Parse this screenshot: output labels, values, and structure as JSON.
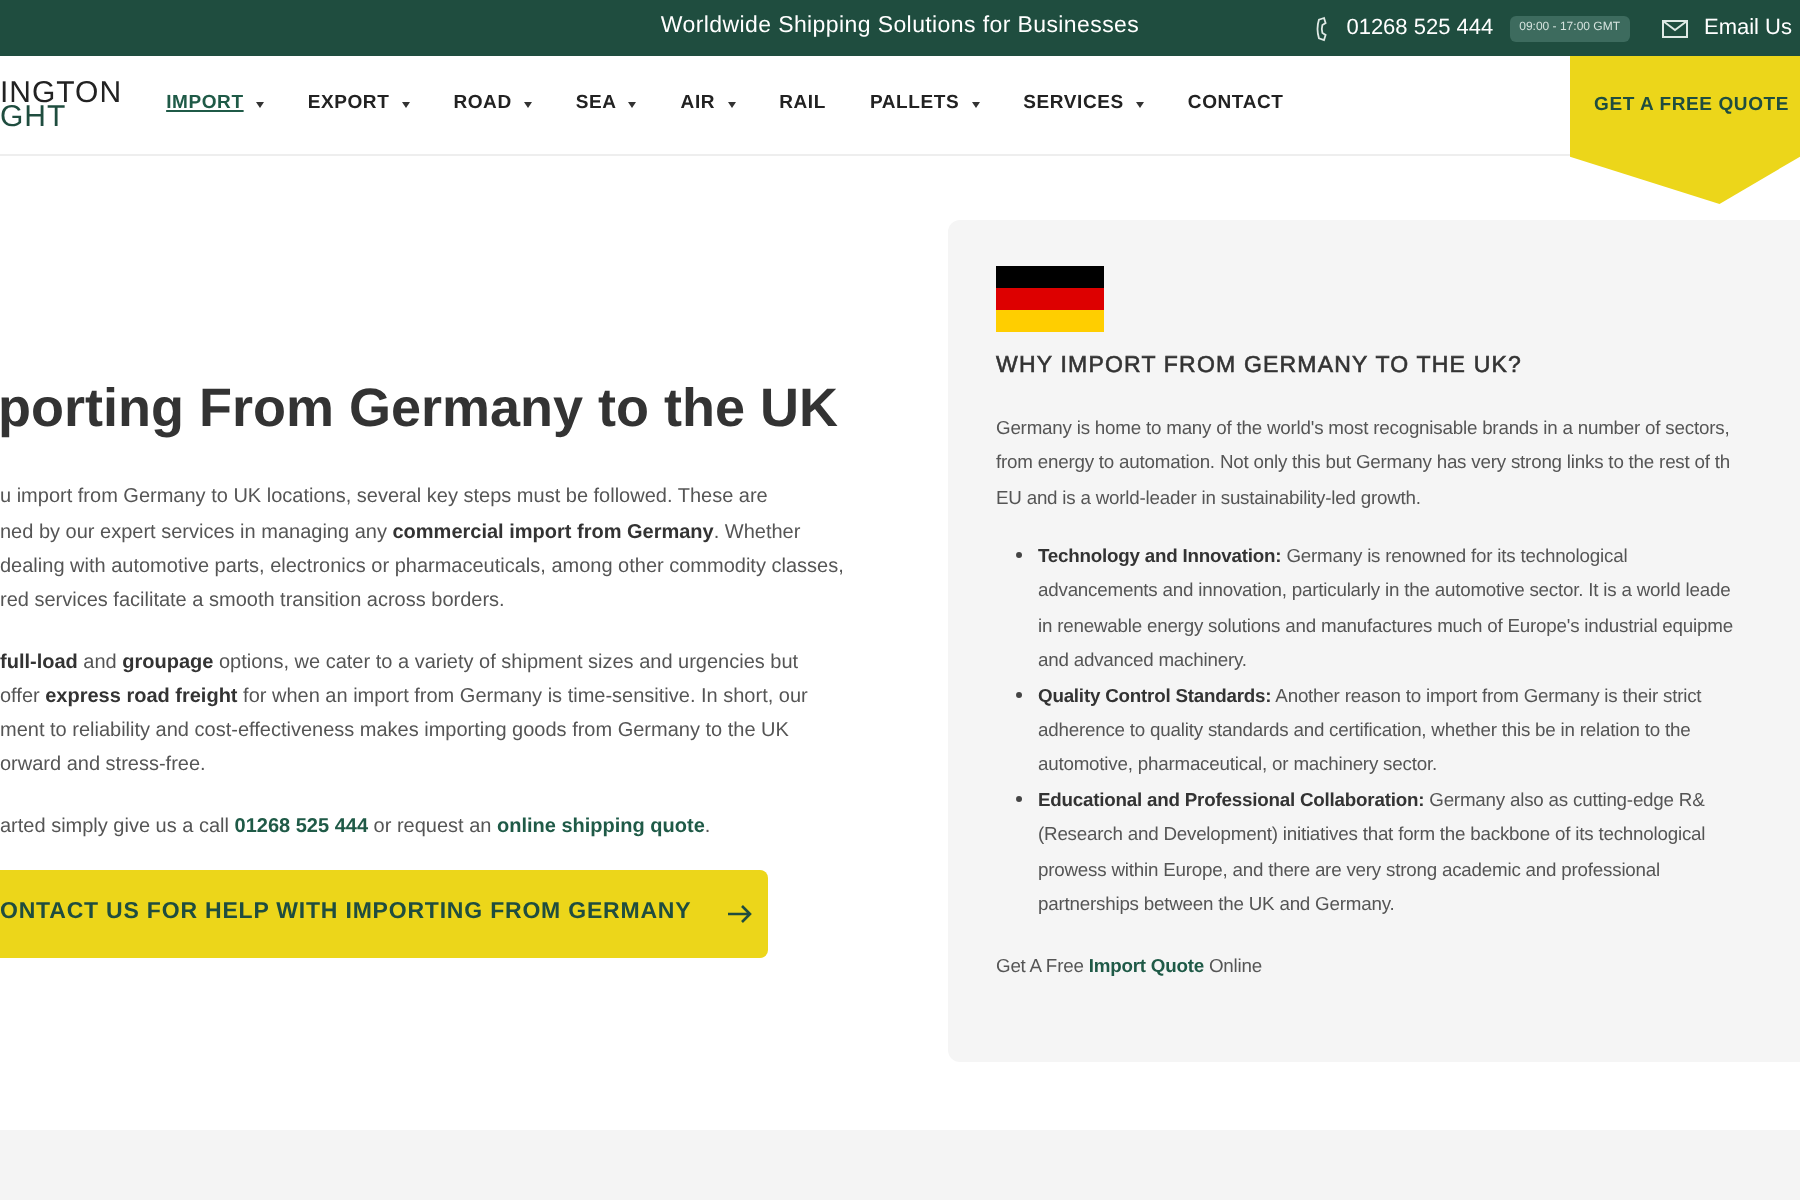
{
  "top_bar": {
    "tagline": "Worldwide Shipping Solutions for Businesses",
    "phone": "01268 525 444",
    "hours": "09:00 - 17:00 GMT",
    "email": "Email Us"
  },
  "header": {
    "logo_lines": [
      "INGTON",
      "GHT"
    ],
    "nav": [
      {
        "label": "IMPORT",
        "selected": true,
        "dropdown": true
      },
      {
        "label": "EXPORT",
        "selected": false,
        "dropdown": true
      },
      {
        "label": "ROAD",
        "selected": false,
        "dropdown": true
      },
      {
        "label": "SEA",
        "selected": false,
        "dropdown": true
      },
      {
        "label": "AIR",
        "selected": false,
        "dropdown": true
      },
      {
        "label": "RAIL",
        "selected": false,
        "dropdown": false
      },
      {
        "label": "PALLETS",
        "selected": false,
        "dropdown": true
      },
      {
        "label": "SERVICES",
        "selected": false,
        "dropdown": true
      },
      {
        "label": "CONTACT",
        "selected": false,
        "dropdown": false
      }
    ],
    "cta": "GET A FREE QUOTE"
  },
  "main": {
    "heading": "porting From Germany to the UK",
    "paragraphs": [
      {
        "lines": [
          [
            {
              "kind": "plain",
              "t": "u import from Germany to UK locations, several key steps must be followed. These are"
            }
          ],
          [
            {
              "kind": "plain",
              "t": "ned by our expert services in managing any "
            },
            {
              "kind": "bold",
              "t": "commercial import from Germany"
            },
            {
              "kind": "plain",
              "t": ". Whether"
            }
          ],
          [
            {
              "kind": "plain",
              "t": "dealing with automotive parts, electronics or pharmaceuticals, among other commodity classes,"
            }
          ],
          [
            {
              "kind": "plain",
              "t": "red services facilitate a smooth transition across borders."
            }
          ]
        ]
      },
      {
        "lines": [
          [
            {
              "kind": "bold",
              "t": "full-load"
            },
            {
              "kind": "plain",
              "t": " and "
            },
            {
              "kind": "bold",
              "t": "groupage"
            },
            {
              "kind": "plain",
              "t": " options, we cater to a variety of shipment sizes and urgencies but"
            }
          ],
          [
            {
              "kind": "plain",
              "t": "offer "
            },
            {
              "kind": "bold",
              "t": "express road freight"
            },
            {
              "kind": "plain",
              "t": " for when an import from Germany is time-sensitive. In short, our"
            }
          ],
          [
            {
              "kind": "plain",
              "t": "ment to reliability and cost-effectiveness makes importing goods from Germany to the UK"
            }
          ],
          [
            {
              "kind": "plain",
              "t": "orward and stress-free."
            }
          ]
        ]
      },
      {
        "lines": [
          [
            {
              "kind": "plain",
              "t": "arted simply give us a call "
            },
            {
              "kind": "link",
              "t": "01268 525 444"
            },
            {
              "kind": "plain",
              "t": " or request an "
            },
            {
              "kind": "link",
              "t": "online shipping quote"
            },
            {
              "kind": "plain",
              "t": "."
            }
          ]
        ]
      }
    ],
    "button": "ONTACT US FOR HELP WITH IMPORTING FROM GERMANY"
  },
  "side_panel": {
    "heading": "WHY IMPORT FROM GERMANY TO THE UK?",
    "intro": {
      "lines": [
        [
          {
            "kind": "plain",
            "t": "Germany is home to many of the world's most recognisable brands in a number of sectors,"
          }
        ],
        [
          {
            "kind": "plain",
            "t": "from energy to automation. Not only this but Germany has very strong links to the rest of th"
          }
        ],
        [
          {
            "kind": "plain",
            "t": "EU and is a world-leader in sustainability-led growth."
          }
        ]
      ]
    },
    "bullets": [
      {
        "lines": [
          [
            {
              "kind": "bold",
              "t": "Technology and Innovation:"
            },
            {
              "kind": "plain",
              "t": " Germany is renowned for its technological"
            }
          ],
          [
            {
              "kind": "plain",
              "t": "advancements and innovation, particularly in the automotive sector. It is a world leade"
            }
          ],
          [
            {
              "kind": "plain",
              "t": "in renewable energy solutions and manufactures much of Europe's industrial equipme"
            }
          ],
          [
            {
              "kind": "plain",
              "t": "and advanced machinery."
            }
          ]
        ]
      },
      {
        "lines": [
          [
            {
              "kind": "bold",
              "t": "Quality Control Standards:"
            },
            {
              "kind": "plain",
              "t": " Another reason to import from Germany is their strict"
            }
          ],
          [
            {
              "kind": "plain",
              "t": "adherence to quality standards and certification, whether this be in relation to the"
            }
          ],
          [
            {
              "kind": "plain",
              "t": "automotive, pharmaceutical, or machinery sector."
            }
          ]
        ]
      },
      {
        "lines": [
          [
            {
              "kind": "bold",
              "t": "Educational and Professional Collaboration:"
            },
            {
              "kind": "plain",
              "t": " Germany also as cutting-edge R&"
            }
          ],
          [
            {
              "kind": "plain",
              "t": "(Research and Development) initiatives that form the backbone of its technological"
            }
          ],
          [
            {
              "kind": "plain",
              "t": "prowess within Europe, and there are very strong academic and professional"
            }
          ],
          [
            {
              "kind": "plain",
              "t": "partnerships between the UK and Germany."
            }
          ]
        ]
      }
    ],
    "footer": {
      "lines": [
        [
          {
            "kind": "plain",
            "t": "Get A Free "
          },
          {
            "kind": "link",
            "t": "Import Quote"
          },
          {
            "kind": "plain",
            "t": " Online"
          }
        ]
      ]
    }
  }
}
